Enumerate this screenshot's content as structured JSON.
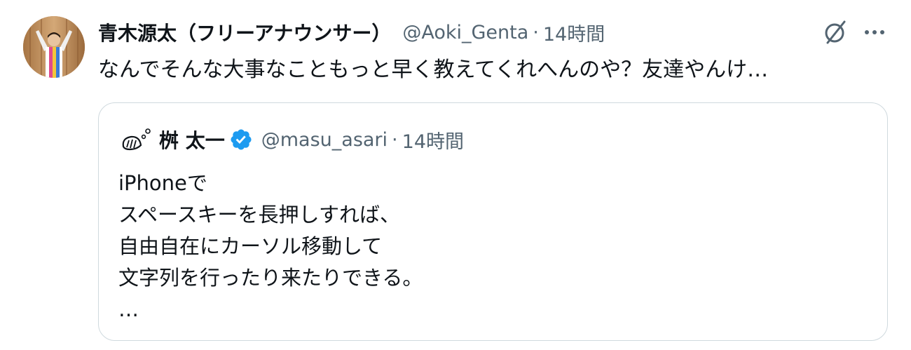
{
  "tweet": {
    "author": {
      "display_name": "青木源太（フリーアナウンサー）",
      "handle": "@Aoki_Genta",
      "separator": "·",
      "time": "14時間"
    },
    "text": "なんでそんな大事なこともっと早く教えてくれへんのや？友達やんけ…",
    "actions": {
      "grok_icon": "slashed-circle-icon",
      "more_icon": "ellipsis-icon"
    }
  },
  "quote": {
    "author": {
      "display_name": "桝 太一",
      "handle": "@masu_asari",
      "separator": "·",
      "time": "14時間",
      "verified": true
    },
    "lines": [
      "iPhoneで",
      "スペースキーを長押しすれば、",
      "自由自在にカーソル移動して",
      "文字列を行ったり来たりできる。",
      "…"
    ]
  },
  "colors": {
    "text_primary": "#0f1419",
    "text_secondary": "#536471",
    "border": "#cfd9de",
    "verified_blue": "#1d9bf0"
  }
}
